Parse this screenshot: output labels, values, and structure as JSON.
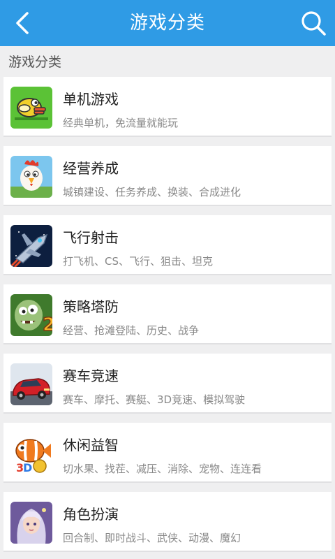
{
  "header": {
    "title": "游戏分类",
    "back_icon": "chevron-left-icon",
    "search_icon": "search-icon",
    "bar_color": "#2f9be5"
  },
  "section": {
    "title": "游戏分类"
  },
  "categories": [
    {
      "title": "单机游戏",
      "desc": "经典单机，免流量就能玩",
      "icon": "flappy-bird-icon"
    },
    {
      "title": "经营养成",
      "desc": "城镇建设、任务养成、换装、合成进化",
      "icon": "chicken-icon"
    },
    {
      "title": "飞行射击",
      "desc": "打飞机、CS、飞行、狙击、坦克",
      "icon": "spaceship-icon"
    },
    {
      "title": "策略塔防",
      "desc": "经营、抢滩登陆、历史、战争",
      "icon": "zombie-icon"
    },
    {
      "title": "赛车竞速",
      "desc": "赛车、摩托、赛艇、3D竞速、模拟驾驶",
      "icon": "race-car-icon"
    },
    {
      "title": "休闲益智",
      "desc": "切水果、找茬、减压、消除、宠物、连连看",
      "icon": "clownfish-icon"
    },
    {
      "title": "角色扮演",
      "desc": "回合制、即时战斗、武侠、动漫、魔幻",
      "icon": "anime-girl-icon"
    }
  ]
}
